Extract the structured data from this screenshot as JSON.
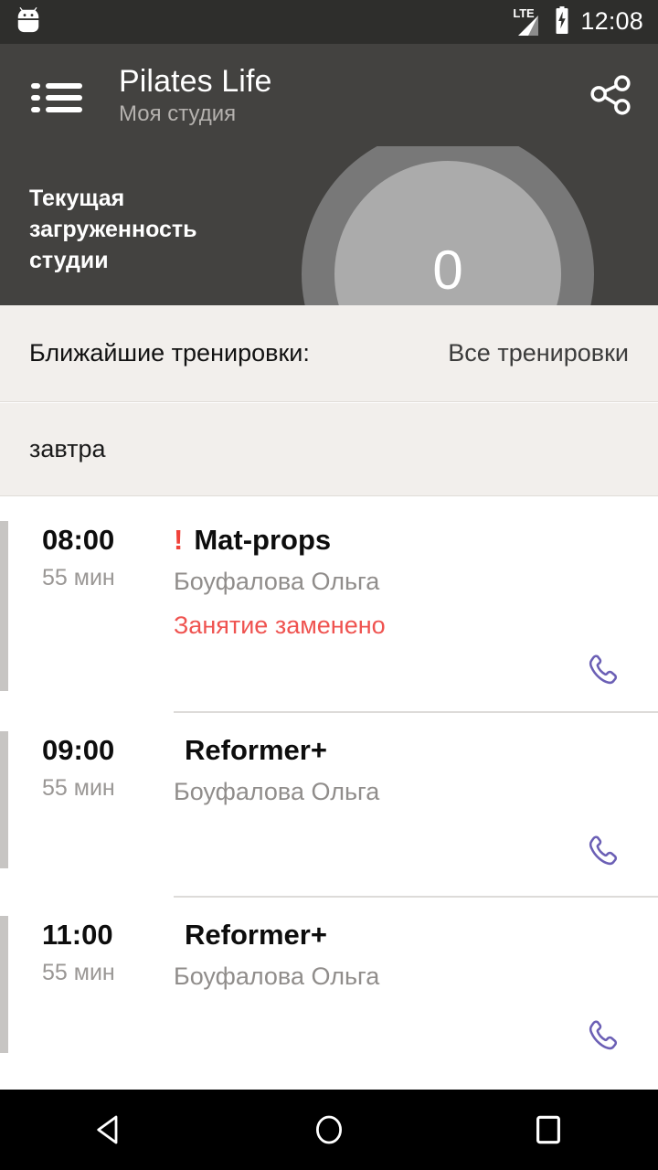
{
  "status_bar": {
    "app_icon": "android-bug-icon",
    "network": "LTE",
    "battery": "charging",
    "clock": "12:08"
  },
  "app_bar": {
    "menu_icon": "list-menu-icon",
    "title": "Pilates Life",
    "subtitle": "Моя студия",
    "share_icon": "share-icon"
  },
  "occupancy": {
    "label": "Текущая загруженность студии",
    "value": "0",
    "colors": {
      "background": "#434240",
      "ring_outer": "#787878",
      "ring_inner": "#ababab"
    }
  },
  "upcoming": {
    "label": "Ближайшие тренировки:",
    "all_link": "Все тренировки"
  },
  "day_header": {
    "label": "завтра"
  },
  "lessons": [
    {
      "time": "08:00",
      "duration": "55 мин",
      "alert": "!",
      "title": "Mat-props",
      "trainer": "Боуфалова Ольга",
      "note": "Занятие заменено",
      "phone_icon": "phone-icon"
    },
    {
      "time": "09:00",
      "duration": "55 мин",
      "alert": "",
      "title": "Reformer+",
      "trainer": "Боуфалова Ольга",
      "note": "",
      "phone_icon": "phone-icon"
    },
    {
      "time": "11:00",
      "duration": "55 мин",
      "alert": "",
      "title": "Reformer+",
      "trainer": "Боуфалова Ольга",
      "note": "",
      "phone_icon": "phone-icon"
    }
  ],
  "nav_bar": {
    "back": "back-triangle-icon",
    "home": "home-circle-icon",
    "recents": "recents-square-icon"
  }
}
